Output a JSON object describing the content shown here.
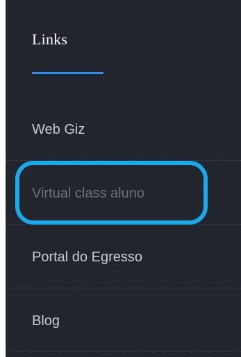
{
  "section": {
    "title": "Links"
  },
  "links": [
    {
      "label": "Web Giz"
    },
    {
      "label": "Virtual class aluno"
    },
    {
      "label": "Portal do Egresso"
    },
    {
      "label": "Blog"
    }
  ],
  "colors": {
    "panel_background": "#22252d",
    "accent_underline": "#2e8ff0",
    "highlight_ring": "#1aa9ea",
    "link_text": "#c9cbcf",
    "link_text_dim": "#6c7079"
  }
}
